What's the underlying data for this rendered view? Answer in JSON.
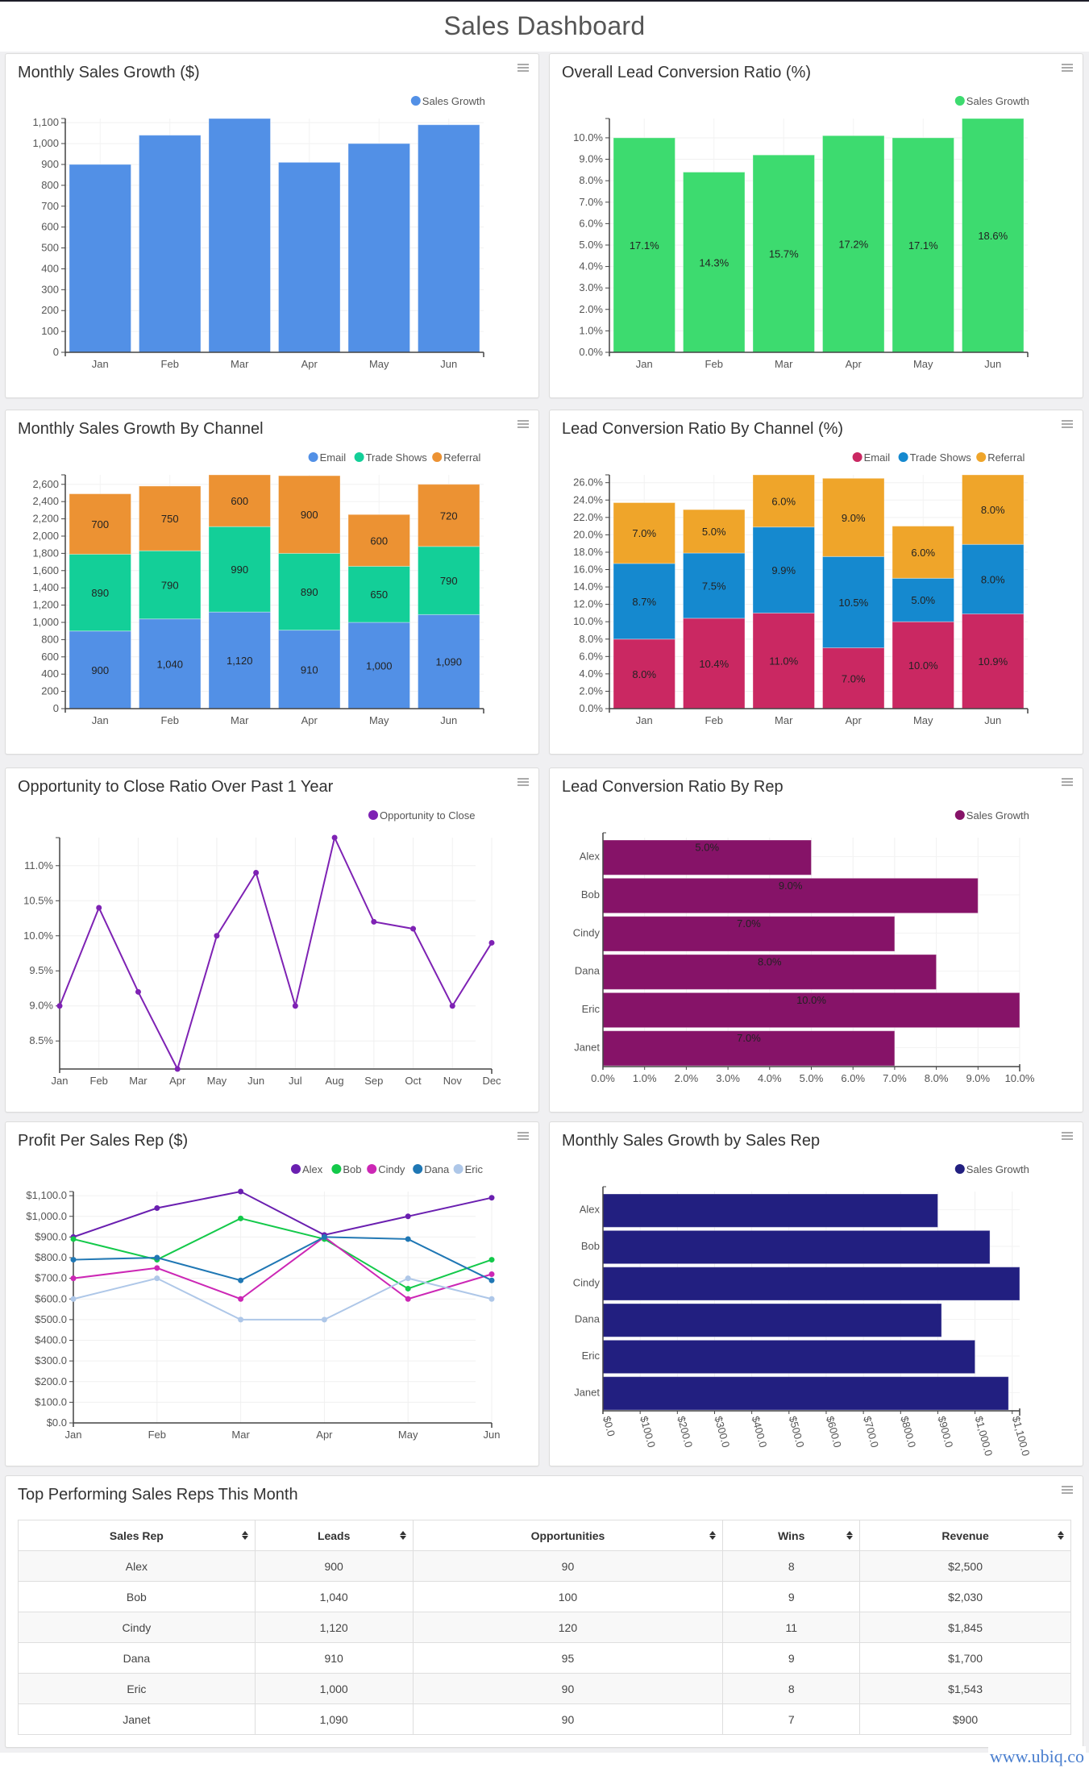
{
  "page": {
    "title": "Sales Dashboard",
    "footer_link": "www.ubiq.co"
  },
  "colors": {
    "blue": "#5290e6",
    "green": "#3ddb6f",
    "teal": "#13cf98",
    "orange": "#ec9233",
    "crimson": "#ca2862",
    "sky": "#1589cf",
    "amber": "#efa52a",
    "purple": "#7e22b4",
    "plum": "#861368",
    "navy": "#221f80"
  },
  "chart_data": [
    {
      "id": "monthly_sales_growth",
      "type": "bar",
      "title": "Monthly Sales Growth ($)",
      "categories": [
        "Jan",
        "Feb",
        "Mar",
        "Apr",
        "May",
        "Jun"
      ],
      "series": [
        {
          "name": "Sales Growth",
          "color": "#5290e6",
          "values": [
            900,
            1040,
            1120,
            910,
            1000,
            1090
          ]
        }
      ],
      "yticks": [
        0,
        100,
        200,
        300,
        400,
        500,
        600,
        700,
        800,
        900,
        1000,
        1100
      ],
      "ytick_labels": [
        "0",
        "100",
        "200",
        "300",
        "400",
        "500",
        "600",
        "700",
        "800",
        "900",
        "1,000",
        "1,100"
      ],
      "ylim": [
        0,
        1120
      ],
      "legend": "top-right",
      "grid": true
    },
    {
      "id": "overall_lead_conversion",
      "type": "bar",
      "title": "Overall Lead Conversion Ratio (%)",
      "categories": [
        "Jan",
        "Feb",
        "Mar",
        "Apr",
        "May",
        "Jun"
      ],
      "series": [
        {
          "name": "Sales Growth",
          "color": "#3ddb6f",
          "values": [
            10.0,
            8.4,
            9.2,
            10.1,
            10.0,
            10.9
          ]
        }
      ],
      "data_labels": [
        "17.1%",
        "14.3%",
        "15.7%",
        "17.2%",
        "17.1%",
        "18.6%"
      ],
      "yticks": [
        0,
        1,
        2,
        3,
        4,
        5,
        6,
        7,
        8,
        9,
        10
      ],
      "ytick_labels": [
        "0.0%",
        "1.0%",
        "2.0%",
        "3.0%",
        "4.0%",
        "5.0%",
        "6.0%",
        "7.0%",
        "8.0%",
        "9.0%",
        "10.0%"
      ],
      "ylim": [
        0,
        10.9
      ],
      "legend": "top-right",
      "grid": true
    },
    {
      "id": "sales_growth_by_channel",
      "type": "bar",
      "stacked": true,
      "title": "Monthly Sales Growth By Channel",
      "categories": [
        "Jan",
        "Feb",
        "Mar",
        "Apr",
        "May",
        "Jun"
      ],
      "series": [
        {
          "name": "Email",
          "color": "#5290e6",
          "values": [
            900,
            1040,
            1120,
            910,
            1000,
            1090
          ],
          "labels": [
            "900",
            "1,040",
            "1,120",
            "910",
            "1,000",
            "1,090"
          ]
        },
        {
          "name": "Trade Shows",
          "color": "#13cf98",
          "values": [
            890,
            790,
            990,
            890,
            650,
            790
          ],
          "labels": [
            "890",
            "790",
            "990",
            "890",
            "650",
            "790"
          ]
        },
        {
          "name": "Referral",
          "color": "#ec9233",
          "values": [
            700,
            750,
            600,
            900,
            600,
            720
          ],
          "labels": [
            "700",
            "750",
            "600",
            "900",
            "600",
            "720"
          ]
        }
      ],
      "yticks": [
        0,
        200,
        400,
        600,
        800,
        1000,
        1200,
        1400,
        1600,
        1800,
        2000,
        2200,
        2400,
        2600
      ],
      "ytick_labels": [
        "0",
        "200",
        "400",
        "600",
        "800",
        "1,000",
        "1,200",
        "1,400",
        "1,600",
        "1,800",
        "2,000",
        "2,200",
        "2,400",
        "2,600"
      ],
      "ylim": [
        0,
        2710
      ],
      "legend": "top-right",
      "grid": true
    },
    {
      "id": "lead_conversion_by_channel",
      "type": "bar",
      "stacked": true,
      "title": "Lead Conversion Ratio By Channel (%)",
      "categories": [
        "Jan",
        "Feb",
        "Mar",
        "Apr",
        "May",
        "Jun"
      ],
      "series": [
        {
          "name": "Email",
          "color": "#ca2862",
          "values": [
            8.0,
            10.4,
            11.0,
            7.0,
            10.0,
            10.9
          ],
          "labels": [
            "8.0%",
            "10.4%",
            "11.0%",
            "7.0%",
            "10.0%",
            "10.9%"
          ]
        },
        {
          "name": "Trade Shows",
          "color": "#1589cf",
          "values": [
            8.7,
            7.5,
            9.9,
            10.5,
            5.0,
            8.0
          ],
          "labels": [
            "8.7%",
            "7.5%",
            "9.9%",
            "10.5%",
            "5.0%",
            "8.0%"
          ]
        },
        {
          "name": "Referral",
          "color": "#efa52a",
          "values": [
            7.0,
            5.0,
            6.0,
            9.0,
            6.0,
            8.0
          ],
          "labels": [
            "7.0%",
            "5.0%",
            "6.0%",
            "9.0%",
            "6.0%",
            "8.0%"
          ]
        }
      ],
      "yticks": [
        0,
        2,
        4,
        6,
        8,
        10,
        12,
        14,
        16,
        18,
        20,
        22,
        24,
        26
      ],
      "ytick_labels": [
        "0.0%",
        "2.0%",
        "4.0%",
        "6.0%",
        "8.0%",
        "10.0%",
        "12.0%",
        "14.0%",
        "16.0%",
        "18.0%",
        "20.0%",
        "22.0%",
        "24.0%",
        "26.0%"
      ],
      "ylim": [
        0,
        26.9
      ],
      "legend": "top-right",
      "grid": true
    },
    {
      "id": "opportunity_to_close",
      "type": "line",
      "title": "Opportunity to Close Ratio Over Past 1 Year",
      "categories": [
        "Jan",
        "Feb",
        "Mar",
        "Apr",
        "May",
        "Jun",
        "Jul",
        "Aug",
        "Sep",
        "Oct",
        "Nov",
        "Dec"
      ],
      "series": [
        {
          "name": "Opportunity to Close",
          "color": "#7e22b4",
          "values": [
            9.0,
            10.4,
            9.2,
            8.1,
            10.0,
            10.9,
            9.0,
            11.4,
            10.2,
            10.1,
            9.0,
            9.9
          ]
        }
      ],
      "yticks": [
        8.5,
        9.0,
        9.5,
        10.0,
        10.5,
        11.0
      ],
      "ytick_labels": [
        "8.5%",
        "9.0%",
        "9.5%",
        "10.0%",
        "10.5%",
        "11.0%"
      ],
      "ylim": [
        8.1,
        11.4
      ],
      "legend": "top-right",
      "grid": true
    },
    {
      "id": "lead_conversion_by_rep",
      "type": "bar",
      "orientation": "horizontal",
      "title": "Lead Conversion Ratio By Rep",
      "categories": [
        "Alex",
        "Bob",
        "Cindy",
        "Dana",
        "Eric",
        "Janet"
      ],
      "series": [
        {
          "name": "Sales Growth",
          "color": "#861368",
          "values": [
            5.0,
            9.0,
            7.0,
            8.0,
            10.0,
            7.0
          ]
        }
      ],
      "data_labels": [
        "5.0%",
        "9.0%",
        "7.0%",
        "8.0%",
        "10.0%",
        "7.0%"
      ],
      "xticks": [
        0,
        1,
        2,
        3,
        4,
        5,
        6,
        7,
        8,
        9,
        10
      ],
      "xtick_labels": [
        "0.0%",
        "1.0%",
        "2.0%",
        "3.0%",
        "4.0%",
        "5.0%",
        "6.0%",
        "7.0%",
        "8.0%",
        "9.0%",
        "10.0%"
      ],
      "xlim": [
        0,
        10
      ],
      "legend": "top-right",
      "grid": true
    },
    {
      "id": "profit_per_rep",
      "type": "line",
      "title": "Profit Per Sales Rep ($)",
      "categories": [
        "Jan",
        "Feb",
        "Mar",
        "Apr",
        "May",
        "Jun"
      ],
      "series": [
        {
          "name": "Alex",
          "color": "#6a1fb0",
          "values": [
            900,
            1040,
            1120,
            910,
            1000,
            1090
          ]
        },
        {
          "name": "Bob",
          "color": "#13c94a",
          "values": [
            890,
            790,
            990,
            890,
            650,
            790
          ]
        },
        {
          "name": "Cindy",
          "color": "#cc27b5",
          "values": [
            700,
            750,
            600,
            900,
            600,
            720
          ]
        },
        {
          "name": "Dana",
          "color": "#1f77b4",
          "values": [
            790,
            800,
            690,
            900,
            890,
            690
          ]
        },
        {
          "name": "Eric",
          "color": "#aec7e8",
          "values": [
            600,
            700,
            500,
            500,
            700,
            600
          ]
        }
      ],
      "yticks": [
        0,
        100,
        200,
        300,
        400,
        500,
        600,
        700,
        800,
        900,
        1000,
        1100
      ],
      "ytick_labels": [
        "$0.0",
        "$100.0",
        "$200.0",
        "$300.0",
        "$400.0",
        "$500.0",
        "$600.0",
        "$700.0",
        "$800.0",
        "$900.0",
        "$1,000.0",
        "$1,100.0"
      ],
      "ylim": [
        0,
        1120
      ],
      "legend": "top-right",
      "grid": true
    },
    {
      "id": "sales_growth_by_rep",
      "type": "bar",
      "orientation": "horizontal",
      "title": "Monthly Sales Growth by Sales Rep",
      "categories": [
        "Alex",
        "Bob",
        "Cindy",
        "Dana",
        "Eric",
        "Janet"
      ],
      "series": [
        {
          "name": "Sales Growth",
          "color": "#221f80",
          "values": [
            900,
            1040,
            1120,
            910,
            1000,
            1090
          ]
        }
      ],
      "xticks": [
        0,
        100,
        200,
        300,
        400,
        500,
        600,
        700,
        800,
        900,
        1000,
        1100
      ],
      "xtick_labels": [
        "$0.0",
        "$100.0",
        "$200.0",
        "$300.0",
        "$400.0",
        "$500.0",
        "$600.0",
        "$700.0",
        "$800.0",
        "$900.0",
        "$1,000.0",
        "$1,100.0"
      ],
      "xlim": [
        0,
        1120
      ],
      "legend": "top-right",
      "grid": true
    }
  ],
  "table": {
    "title": "Top Performing Sales Reps This Month",
    "columns": [
      "Sales Rep",
      "Leads",
      "Opportunities",
      "Wins",
      "Revenue"
    ],
    "rows": [
      [
        "Alex",
        "900",
        "90",
        "8",
        "$2,500"
      ],
      [
        "Bob",
        "1,040",
        "100",
        "9",
        "$2,030"
      ],
      [
        "Cindy",
        "1,120",
        "120",
        "11",
        "$1,845"
      ],
      [
        "Dana",
        "910",
        "95",
        "9",
        "$1,700"
      ],
      [
        "Eric",
        "1,000",
        "90",
        "8",
        "$1,543"
      ],
      [
        "Janet",
        "1,090",
        "90",
        "7",
        "$900"
      ]
    ]
  }
}
